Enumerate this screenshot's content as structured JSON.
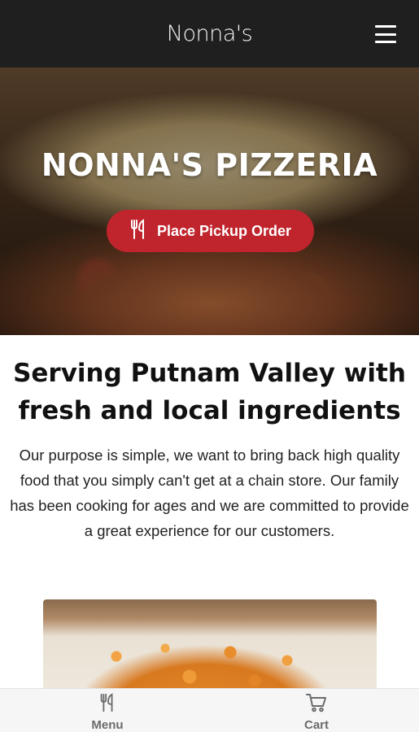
{
  "header": {
    "brand": "Nonna's",
    "menu_icon": "hamburger-icon"
  },
  "hero": {
    "title": "NONNA'S PIZZERIA",
    "order_button": {
      "icon": "utensils-icon",
      "label": "Place Pickup Order"
    }
  },
  "intro": {
    "headline": "Serving Putnam Valley with fresh and local ingredients",
    "paragraph": "Our purpose is simple, we want to bring back high quality food that you simply can't get at a chain store. Our family has been cooking for ages and we are committed to provide a great experience for our customers."
  },
  "tabbar": {
    "items": [
      {
        "label": "Menu",
        "icon": "utensils-icon"
      },
      {
        "label": "Cart",
        "icon": "cart-icon"
      }
    ]
  },
  "colors": {
    "header_bg": "#1f1f1f",
    "accent": "#c0242c",
    "tabbar_bg": "#f6f6f6"
  }
}
